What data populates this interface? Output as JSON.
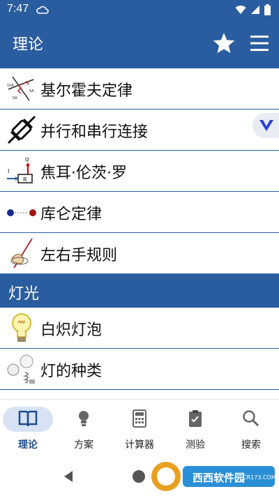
{
  "status": {
    "time": "7:47"
  },
  "appbar": {
    "title": "理论",
    "star_icon": "star-icon",
    "menu_icon": "menu-icon"
  },
  "theory_items": [
    {
      "label": "基尔霍夫定律",
      "icon": "kirchhoff-icon"
    },
    {
      "label": "并行和串行连接",
      "icon": "resistors-connection-icon"
    },
    {
      "label": "焦耳·伦茨·罗",
      "icon": "joule-lenz-icon"
    },
    {
      "label": "库仑定律",
      "icon": "coulomb-icon"
    },
    {
      "label": "左右手规则",
      "icon": "hand-rule-icon"
    }
  ],
  "section_light": {
    "title": "灯光"
  },
  "light_items": [
    {
      "label": "白炽灯泡",
      "icon": "light-bulb-icon"
    },
    {
      "label": "灯的种类",
      "icon": "lamp-types-icon"
    }
  ],
  "bottom_nav": [
    {
      "label": "理论",
      "icon": "book-icon",
      "active": true
    },
    {
      "label": "方案",
      "icon": "lightbulb-icon"
    },
    {
      "label": "计算器",
      "icon": "calculator-icon"
    },
    {
      "label": "测验",
      "icon": "clipboard-icon"
    },
    {
      "label": "搜索",
      "icon": "search-icon"
    }
  ],
  "watermark": {
    "text": "西西软件园",
    "subtext": "CR173.COM"
  },
  "colors": {
    "primary": "#2a5d9f",
    "active_pill": "#d7e3f4"
  }
}
